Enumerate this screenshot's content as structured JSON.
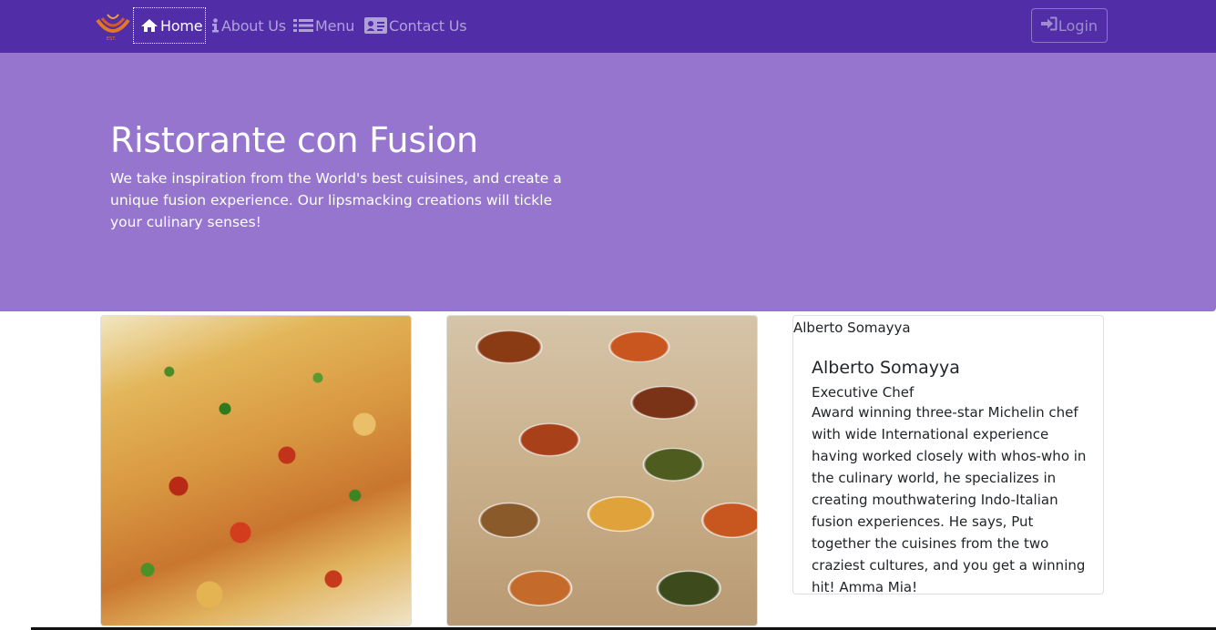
{
  "navbar": {
    "logo_alt": "Ristorante Con Fusion",
    "items": [
      {
        "label": "Home",
        "icon": "home-icon",
        "active": true
      },
      {
        "label": "About Us",
        "icon": "info-icon",
        "active": false
      },
      {
        "label": "Menu",
        "icon": "list-icon",
        "active": false
      },
      {
        "label": "Contact Us",
        "icon": "address-card-icon",
        "active": false
      }
    ],
    "login_label": "Login",
    "colors": {
      "background": "#512da8"
    }
  },
  "jumbotron": {
    "title": "Ristorante con Fusion",
    "text": "We take inspiration from the World's best cuisines, and create a unique fusion experience. Our lipsmacking creations will tickle your culinary senses!",
    "colors": {
      "background": "#9575cd"
    }
  },
  "cards": {
    "dish_image": "pizza-image",
    "promotion_image": "buffet-image",
    "leader": {
      "image_alt": "Alberto Somayya",
      "name": "Alberto Somayya",
      "designation": "Executive Chef",
      "description": "Award winning three-star Michelin chef with wide International experience having worked closely with whos-who in the culinary world, he specializes in creating mouthwatering Indo-Italian fusion experiences. He says, Put together the cuisines from the two craziest cultures, and you get a winning hit! Amma Mia!"
    }
  }
}
